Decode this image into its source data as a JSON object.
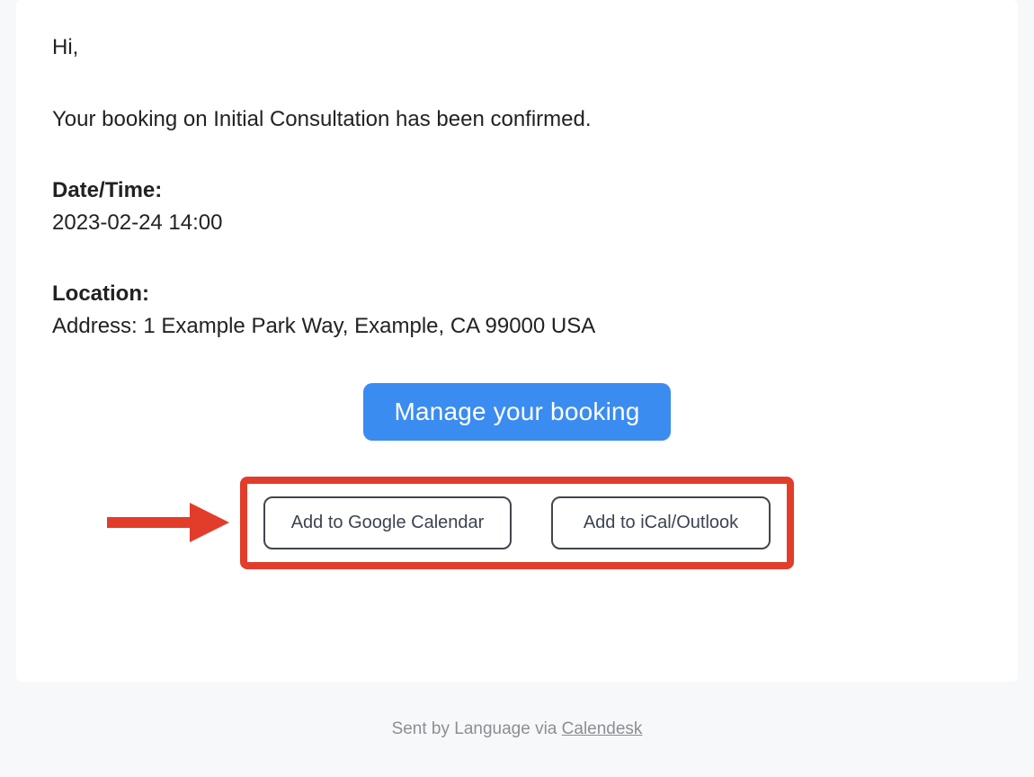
{
  "email": {
    "greeting": "Hi,",
    "confirm_text": "Your booking on Initial Consultation has been confirmed.",
    "datetime_label": "Date/Time:",
    "datetime_value": "2023-02-24 14:00",
    "location_label": "Location:",
    "location_value": "Address: 1 Example Park Way, Example, CA 99000 USA",
    "manage_button": "Manage your booking",
    "add_google": "Add to Google Calendar",
    "add_ical": "Add to iCal/Outlook"
  },
  "footer": {
    "prefix": "Sent by Language via ",
    "link_text": "Calendesk"
  },
  "annotation": {
    "highlight_color": "#e23d2a"
  }
}
